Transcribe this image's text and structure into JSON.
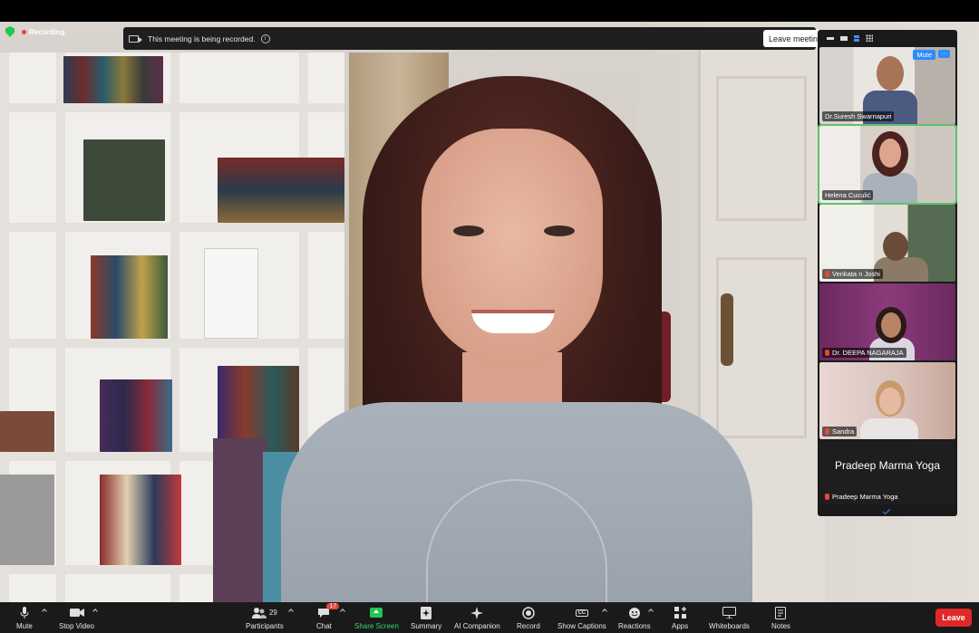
{
  "recording": {
    "label": "Recording"
  },
  "banner": {
    "text": "This meeting is being recorded.",
    "info_icon": "i"
  },
  "header": {
    "leave_meeting": "Leave meeting",
    "view": "View"
  },
  "gallery": {
    "participants": [
      {
        "name": "Dr.Suresh Swarnapuri",
        "muted": false
      },
      {
        "name": "Helena Cuculić",
        "muted": false
      },
      {
        "name": "Venkata n Joshi",
        "muted": true
      },
      {
        "name": "Dr. DEEPA NAGARAJA",
        "muted": true
      },
      {
        "name": "Sandra",
        "muted": true
      },
      {
        "name": "Pradeep Marma Yoga",
        "muted": true
      }
    ],
    "big_name": "Pradeep Marma Yoga",
    "mute_label": "Mute",
    "more_label": "···"
  },
  "toolbar": {
    "mute": "Mute",
    "stop_video": "Stop Video",
    "participants": "Participants",
    "participants_count": "29",
    "chat": "Chat",
    "chat_badge": "17",
    "share_screen": "Share Screen",
    "summary": "Summary",
    "ai_companion": "AI Companion",
    "record": "Record",
    "show_captions": "Show Captions",
    "reactions": "Reactions",
    "apps": "Apps",
    "whiteboards": "Whiteboards",
    "notes": "Notes",
    "leave": "Leave",
    "captions_icon_text": "CC"
  },
  "colors": {
    "accent": "#2d8cff",
    "share": "#23c552",
    "leave": "#e02828",
    "active_speaker": "#5ec26a"
  }
}
